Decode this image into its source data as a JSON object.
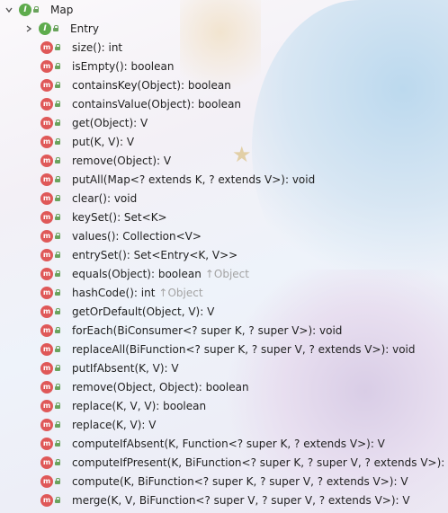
{
  "tree": {
    "root": {
      "label": "Map",
      "icon": "interface-icon"
    },
    "child": {
      "label": "Entry",
      "icon": "interface-icon"
    },
    "methods": [
      {
        "sig": "size(): int"
      },
      {
        "sig": "isEmpty(): boolean"
      },
      {
        "sig": "containsKey(Object): boolean"
      },
      {
        "sig": "containsValue(Object): boolean"
      },
      {
        "sig": "get(Object): V"
      },
      {
        "sig": "put(K, V): V"
      },
      {
        "sig": "remove(Object): V"
      },
      {
        "sig": "putAll(Map<? extends K, ? extends V>): void"
      },
      {
        "sig": "clear(): void"
      },
      {
        "sig": "keySet(): Set<K>"
      },
      {
        "sig": "values(): Collection<V>"
      },
      {
        "sig": "entrySet(): Set<Entry<K, V>>"
      },
      {
        "sig": "equals(Object): boolean",
        "inherit": "↑Object"
      },
      {
        "sig": "hashCode(): int",
        "inherit": "↑Object"
      },
      {
        "sig": "getOrDefault(Object, V): V"
      },
      {
        "sig": "forEach(BiConsumer<? super K, ? super V>): void"
      },
      {
        "sig": "replaceAll(BiFunction<? super K, ? super V, ? extends V>): void"
      },
      {
        "sig": "putIfAbsent(K, V): V"
      },
      {
        "sig": "remove(Object, Object): boolean"
      },
      {
        "sig": "replace(K, V, V): boolean"
      },
      {
        "sig": "replace(K, V): V"
      },
      {
        "sig": "computeIfAbsent(K, Function<? super K, ? extends V>): V"
      },
      {
        "sig": "computeIfPresent(K, BiFunction<? super K, ? super V, ? extends V>): V"
      },
      {
        "sig": "compute(K, BiFunction<? super K, ? super V, ? extends V>): V"
      },
      {
        "sig": "merge(K, V, BiFunction<? super V, ? super V, ? extends V>): V"
      }
    ],
    "icon_glyphs": {
      "interface": "I",
      "method": "m"
    }
  },
  "colors": {
    "interface": "#5eab4d",
    "method": "#df5858",
    "inherited": "#a3a3a3"
  }
}
